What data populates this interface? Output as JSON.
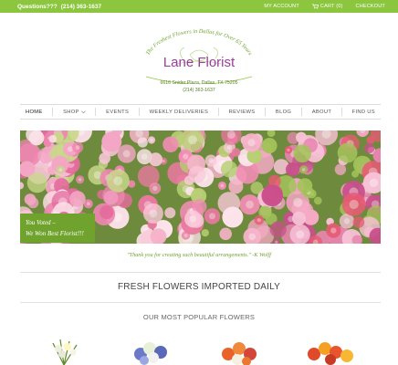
{
  "topbar": {
    "question": "Questions???",
    "phone": "(214) 363-1637",
    "links": [
      "MY ACCOUNT",
      "CART (0)",
      "CHECKOUT"
    ]
  },
  "logo": {
    "tagline": "The Freshest Flowers in Dallas for Over 65 Years",
    "name": "Lane Florist",
    "address": "6616 Snider Plaza, Dallas, TX 75205",
    "phone": "(214) 363-1637"
  },
  "nav": {
    "items": [
      "HOME",
      "SHOP",
      "EVENTS",
      "WEEKLY DELIVERIES",
      "REVIEWS",
      "BLOG",
      "ABOUT",
      "FIND US"
    ]
  },
  "banner": {
    "badge_line1": "You Voted –",
    "badge_line2": "We Won Best Florist!!!"
  },
  "testimonial": "\"Thank you for creating such beautiful arrangements.\" -K Wolff",
  "section": {
    "heading": "FRESH FLOWERS IMPORTED DAILY",
    "subheading": "OUR MOST POPULAR FLOWERS"
  },
  "colors": {
    "brand_green": "#8cc63f",
    "dark_green": "#6fa32d",
    "logo_purple": "#9b3d9b"
  }
}
